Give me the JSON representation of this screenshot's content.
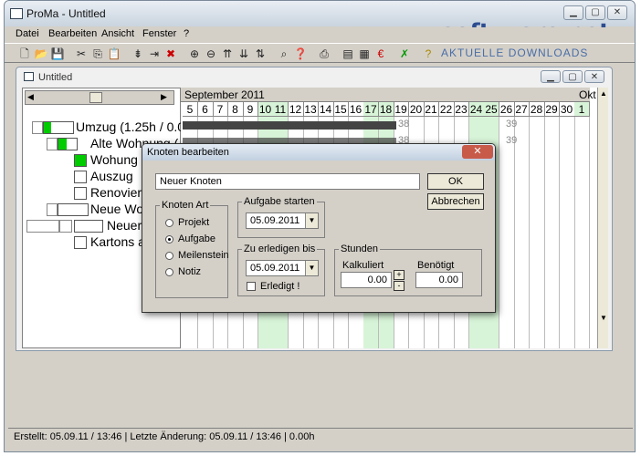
{
  "app": {
    "title": "ProMa - Untitled"
  },
  "menu": [
    "Datei",
    "Bearbeiten",
    "Ansicht",
    "Fenster",
    "?"
  ],
  "toolbar_icons": [
    "new-icon",
    "open-icon",
    "save-icon",
    "cut-icon",
    "copy-icon",
    "paste-icon",
    "insert-node-icon",
    "insert-child-icon",
    "delete-icon",
    "zoom-in-icon",
    "zoom-out-icon",
    "sort-up-icon",
    "sort-down-icon",
    "sort-icon",
    "find-icon",
    "help-icon",
    "print-icon",
    "export-icon",
    "report-icon",
    "euro-icon",
    "clear-icon",
    "question-icon"
  ],
  "watermark": {
    "line1": "soft·ware.net",
    "line2": "AKTUELLE DOWNLOADS"
  },
  "child": {
    "title": "Untitled"
  },
  "tree": {
    "items": [
      {
        "label": "Umzug (1.25h / 0.0"
      },
      {
        "label": "Alte Wohnung ("
      },
      {
        "label": "Wohung k"
      },
      {
        "label": "Auszug"
      },
      {
        "label": "Renovieru"
      },
      {
        "label": "Neue Woh"
      },
      {
        "label": "Neuer K"
      },
      {
        "label": "Kartons au"
      }
    ]
  },
  "calendar": {
    "month1": "September 2011",
    "month2": "Okt",
    "days": [
      "5",
      "6",
      "7",
      "8",
      "9",
      "10",
      "11",
      "12",
      "13",
      "14",
      "15",
      "16",
      "17",
      "18",
      "19",
      "20",
      "21",
      "22",
      "23",
      "24",
      "25",
      "26",
      "27",
      "28",
      "29",
      "30",
      "1"
    ],
    "week_labels": [
      "38",
      "38",
      "39",
      "39"
    ]
  },
  "dialog": {
    "title": "Knoten bearbeiten",
    "name_value": "Neuer Knoten",
    "ok": "OK",
    "cancel": "Abbrechen",
    "knoten_art": "Knoten Art",
    "types": [
      "Projekt",
      "Aufgabe",
      "Meilenstein",
      "Notiz"
    ],
    "selected_type": "Aufgabe",
    "start_label": "Aufgabe starten",
    "start_date": "05.09.2011",
    "due_label": "Zu erledigen bis",
    "due_date": "05.09.2011",
    "done_label": "Erledigt !",
    "hours_label": "Stunden",
    "calc_label": "Kalkuliert",
    "calc_value": "0.00",
    "need_label": "Benötigt",
    "need_value": "0.00",
    "plus": "+",
    "minus": "-"
  },
  "status": {
    "text": "Erstellt: 05.09.11 / 13:46   |  Letzte Änderung: 05.09.11 / 13:46   |  0.00h"
  },
  "colors": {
    "accent": "#00cc00",
    "weekend": "#d8f4d8",
    "dark_bar": "#444444"
  }
}
